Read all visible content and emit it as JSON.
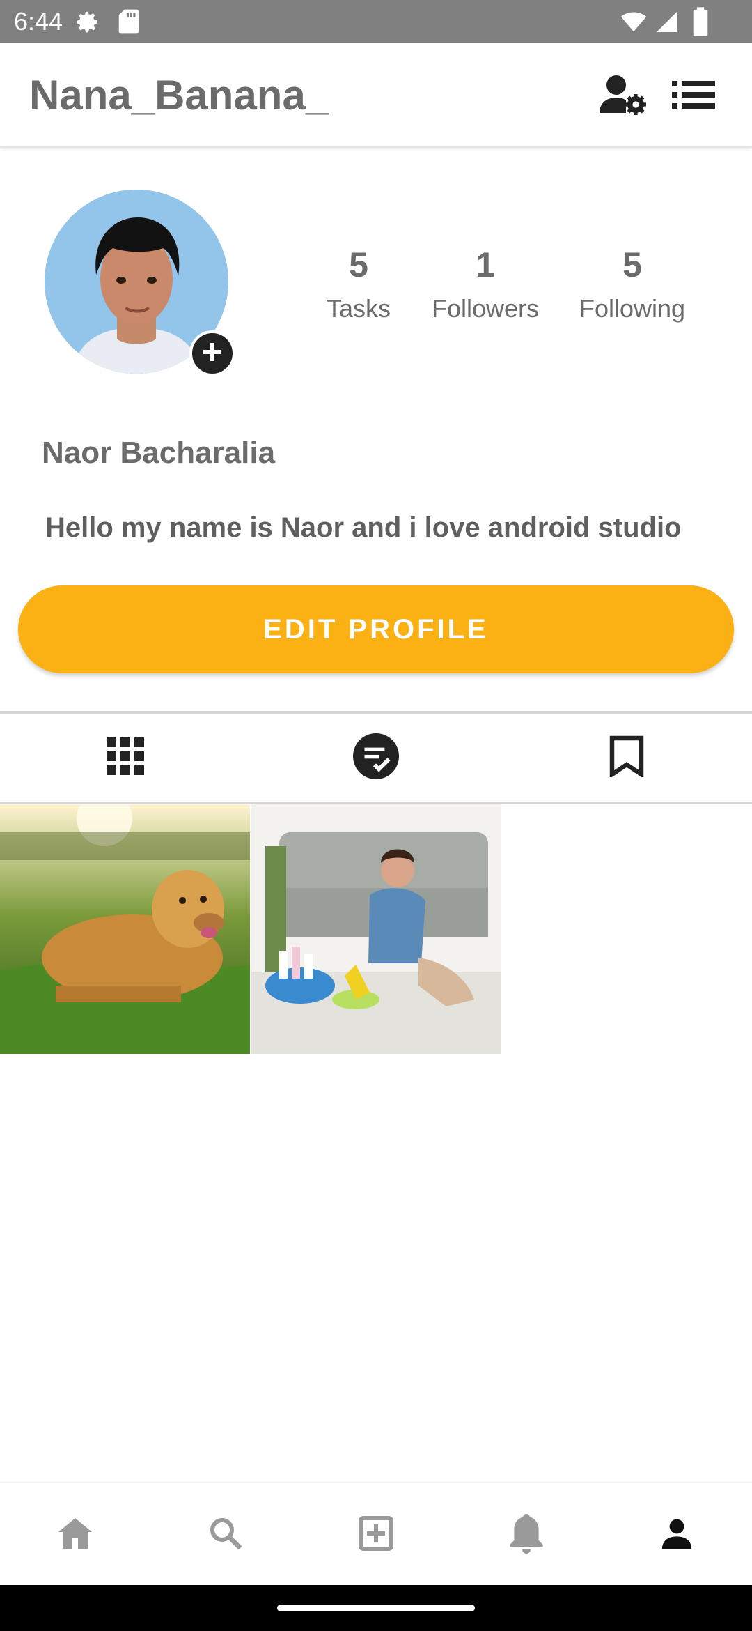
{
  "status_bar": {
    "time": "6:44",
    "icons": [
      "settings-gear-icon",
      "sd-card-icon",
      "wifi-icon",
      "cellular-signal-icon",
      "battery-icon"
    ]
  },
  "header": {
    "username": "Nana_Banana_",
    "icons": [
      "user-settings-icon",
      "menu-list-icon"
    ]
  },
  "profile": {
    "full_name": "Naor Bacharalia",
    "bio": "Hello my name is Naor and i love android studio",
    "stats": [
      {
        "value": "5",
        "label": "Tasks"
      },
      {
        "value": "1",
        "label": "Followers"
      },
      {
        "value": "5",
        "label": "Following"
      }
    ],
    "edit_button": "EDIT PROFILE"
  },
  "tabs": [
    "grid-icon",
    "tasks-check-icon",
    "bookmark-icon"
  ],
  "posts": [
    "golden retriever lying on grass",
    "woman cleaning floor"
  ],
  "bottom_nav": [
    "home-icon",
    "search-icon",
    "add-icon",
    "notifications-icon",
    "profile-icon"
  ],
  "colors": {
    "accent": "#fbb013",
    "status_bar": "#808080",
    "text": "#6b6b6b"
  }
}
